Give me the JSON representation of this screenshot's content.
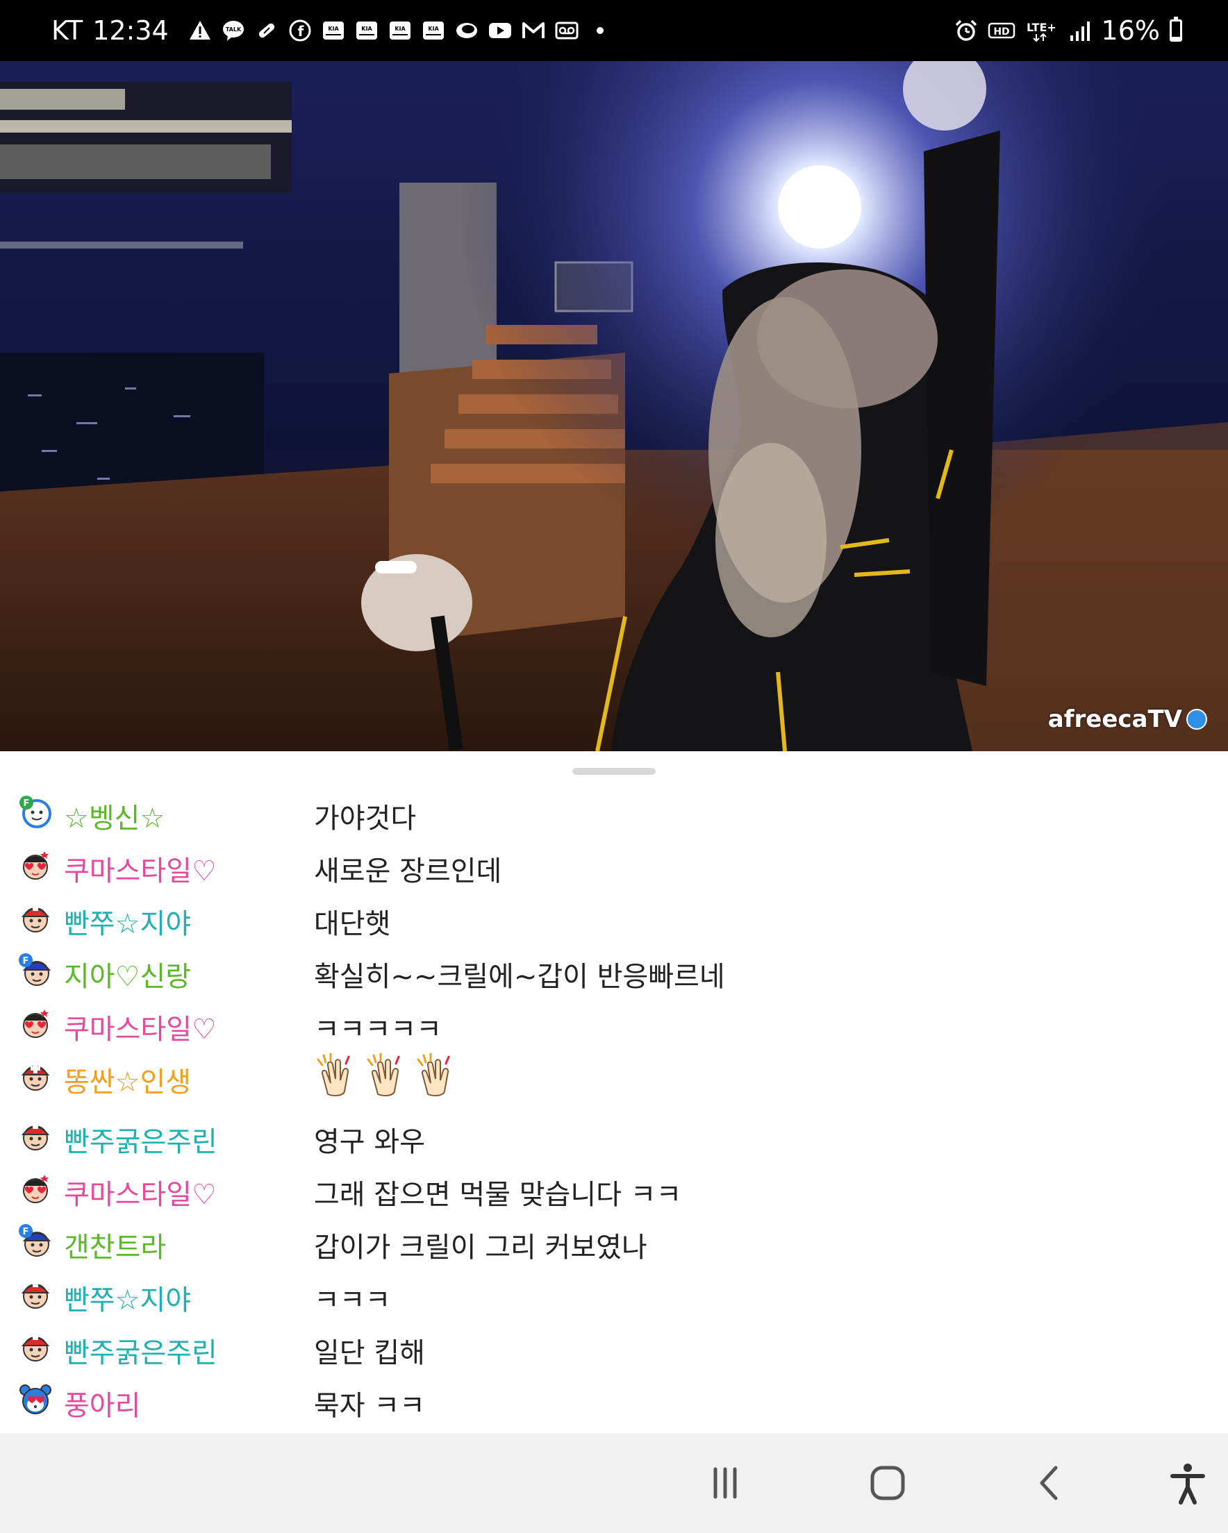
{
  "status_bar": {
    "carrier": "KT",
    "time": "12:34",
    "battery_percent": "16%",
    "battery_level": 0.16,
    "left_icons": [
      "warning-icon",
      "kakaotalk-icon",
      "pill-icon",
      "facebook-icon",
      "kia-connect-icon",
      "kia-connect-icon",
      "kia-connect-icon",
      "kia-connect-icon",
      "ring-icon",
      "youtube-icon",
      "gmail-icon",
      "voicemail-icon",
      "dot-icon"
    ],
    "right_icons": [
      "alarm-icon",
      "hd-voice-icon",
      "lte-plus-icon",
      "signal-icon",
      "battery-icon"
    ],
    "hd_label": "HD",
    "lte_label": "LTE+"
  },
  "video": {
    "watermark": "afreecaTV",
    "watermark_color": "#ffffff"
  },
  "chat": {
    "messages": [
      {
        "nick": "☆벵신☆",
        "nick_color": "#5cb82a",
        "text": "가야것다",
        "avatar": "fan-badge-avatar"
      },
      {
        "nick": "쿠마스타일♡",
        "nick_color": "#e44a9b",
        "text": "새로운 장르인데",
        "avatar": "heart-glasses-avatar"
      },
      {
        "nick": "빤쭈☆지야",
        "nick_color": "#20b0b0",
        "text": "대단햇",
        "avatar": "red-cap-avatar"
      },
      {
        "nick": "지아♡신랑",
        "nick_color": "#5cb82a",
        "text": "확실히~~크릴에~갑이 반응빠르네",
        "avatar": "fan-cap-avatar"
      },
      {
        "nick": "쿠마스타일♡",
        "nick_color": "#e44a9b",
        "text": "ㅋㅋㅋㅋㅋ",
        "avatar": "heart-glasses-avatar"
      },
      {
        "nick": "똥싼☆인생",
        "nick_color": "#f0a020",
        "text": "",
        "avatar": "cross-cap-avatar",
        "emoji": [
          "clapping-hands-emoji",
          "clapping-hands-emoji",
          "clapping-hands-emoji"
        ]
      },
      {
        "nick": "빤주굵은주린",
        "nick_color": "#20b0b0",
        "text": "영구 와우",
        "avatar": "red-cap-avatar"
      },
      {
        "nick": "쿠마스타일♡",
        "nick_color": "#e44a9b",
        "text": "그래 잡으면 먹물 맞습니다 ㅋㅋ",
        "avatar": "heart-glasses-avatar"
      },
      {
        "nick": "갠찬트라",
        "nick_color": "#5cb82a",
        "text": "갑이가 크릴이 그리 커보였나",
        "avatar": "fan-cap-avatar"
      },
      {
        "nick": "빤쭈☆지야",
        "nick_color": "#20b0b0",
        "text": "ㅋㅋㅋ",
        "avatar": "red-cap-avatar"
      },
      {
        "nick": "빤주굵은주린",
        "nick_color": "#20b0b0",
        "text": "일단 킵해",
        "avatar": "red-cap-avatar"
      },
      {
        "nick": "풍아리",
        "nick_color": "#e44a9b",
        "text": "묵자 ㅋㅋ",
        "avatar": "heart-bear-avatar"
      }
    ]
  },
  "nav_bar": {
    "buttons": [
      "recent-apps-icon",
      "home-icon",
      "back-icon",
      "accessibility-icon"
    ]
  }
}
